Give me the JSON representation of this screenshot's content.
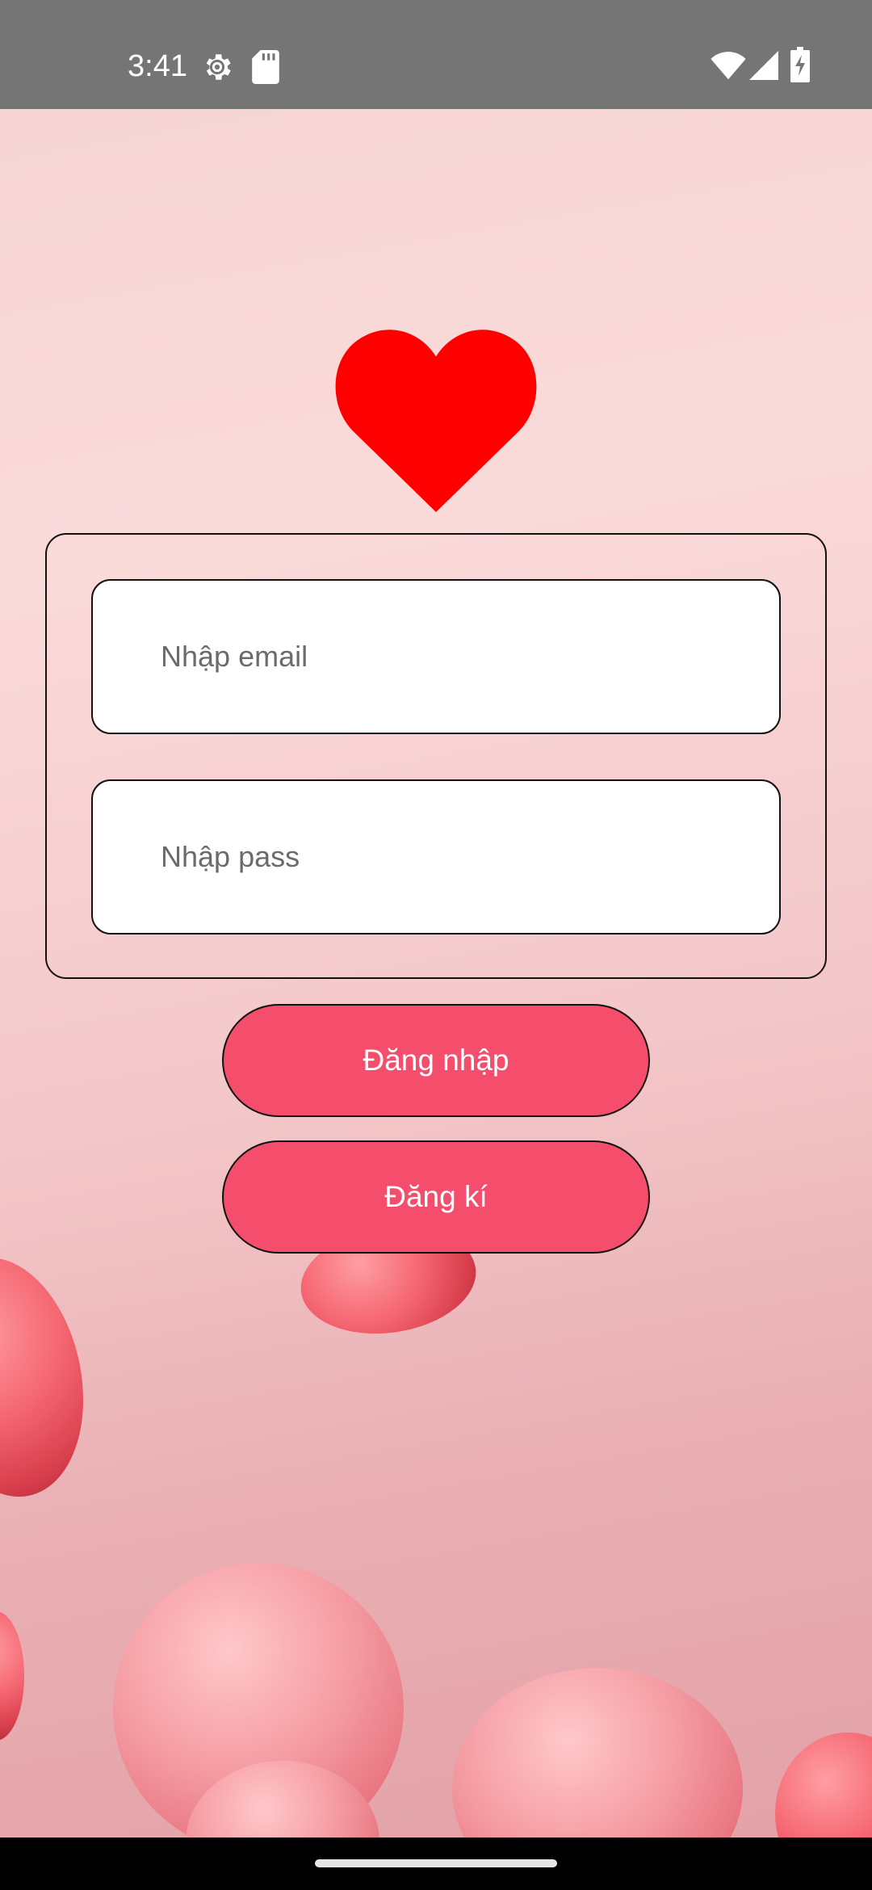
{
  "status_bar": {
    "time": "3:41",
    "icons": [
      "settings-gear-icon",
      "sd-card-icon",
      "wifi-icon",
      "cell-signal-icon",
      "battery-charging-icon"
    ]
  },
  "logo": {
    "icon": "heart-icon",
    "color": "#ff0000"
  },
  "form": {
    "email": {
      "value": "",
      "placeholder": "Nhập email"
    },
    "password": {
      "value": "",
      "placeholder": "Nhập pass"
    }
  },
  "buttons": {
    "login_label": "Đăng nhập",
    "register_label": "Đăng kí",
    "color": "#f44e6c"
  }
}
